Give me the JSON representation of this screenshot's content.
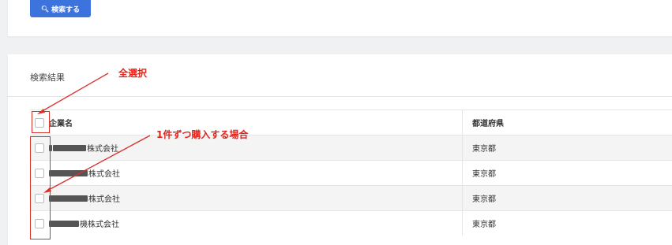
{
  "search": {
    "button_label": "検索する",
    "icon": "search-icon"
  },
  "results": {
    "title": "検索結果",
    "columns": {
      "name": "企業名",
      "prefecture": "都道府県"
    },
    "rows": [
      {
        "name": "株式会社",
        "prefecture": "東京都"
      },
      {
        "name": "株式会社",
        "prefecture": "東京都"
      },
      {
        "name": "株式会社",
        "prefecture": "東京都"
      },
      {
        "name": "機株式会社",
        "prefecture": "東京都"
      }
    ]
  },
  "annotations": {
    "select_all": "全選択",
    "individual": "1件ずつ購入する場合",
    "color": "#e0241c"
  }
}
